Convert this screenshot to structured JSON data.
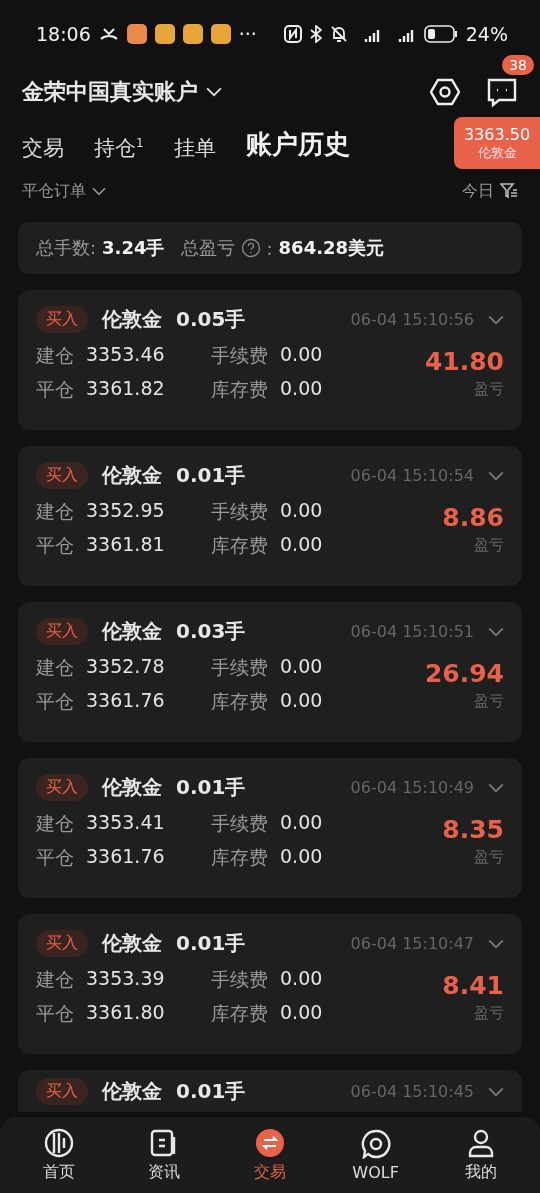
{
  "status_bar": {
    "time": "18:06",
    "more": "···",
    "battery_text": "24%"
  },
  "header": {
    "account": "金荣中国真实账户",
    "badge": "38",
    "price": {
      "value": "3363.50",
      "symbol": "伦敦金"
    }
  },
  "tabs": [
    {
      "label": "交易",
      "selected": false
    },
    {
      "label": "持仓$^{1}$",
      "selected": false
    },
    {
      "label": "挂单",
      "selected": false
    },
    {
      "label": "账户历史",
      "selected": true
    }
  ],
  "filter": {
    "type": "平仓订单",
    "range": "今日"
  },
  "summary": {
    "lots_label": "总手数:",
    "lots": "3.24手",
    "pnl_label": "总盈亏",
    "pnl_colon": ":",
    "pnl": "864.28美元"
  },
  "orders": [
    {
      "side": "买入",
      "symbol": "伦敦金",
      "lots": "0.05手",
      "time": "06-04 15:10:56",
      "fields": [
        {
          "label": "建仓",
          "value": "3353.46"
        },
        {
          "label": "手续费",
          "value": "0.00"
        },
        {
          "label": "平仓",
          "value": "3361.82"
        },
        {
          "label": "库存费",
          "value": "0.00"
        }
      ],
      "profit": "41.80",
      "profit_label": "盈亏"
    },
    {
      "side": "买入",
      "symbol": "伦敦金",
      "lots": "0.01手",
      "time": "06-04 15:10:54",
      "fields": [
        {
          "label": "建仓",
          "value": "3352.95"
        },
        {
          "label": "手续费",
          "value": "0.00"
        },
        {
          "label": "平仓",
          "value": "3361.81"
        },
        {
          "label": "库存费",
          "value": "0.00"
        }
      ],
      "profit": "8.86",
      "profit_label": "盈亏"
    },
    {
      "side": "买入",
      "symbol": "伦敦金",
      "lots": "0.03手",
      "time": "06-04 15:10:51",
      "fields": [
        {
          "label": "建仓",
          "value": "3352.78"
        },
        {
          "label": "手续费",
          "value": "0.00"
        },
        {
          "label": "平仓",
          "value": "3361.76"
        },
        {
          "label": "库存费",
          "value": "0.00"
        }
      ],
      "profit": "26.94",
      "profit_label": "盈亏"
    },
    {
      "side": "买入",
      "symbol": "伦敦金",
      "lots": "0.01手",
      "time": "06-04 15:10:49",
      "fields": [
        {
          "label": "建仓",
          "value": "3353.41"
        },
        {
          "label": "手续费",
          "value": "0.00"
        },
        {
          "label": "平仓",
          "value": "3361.76"
        },
        {
          "label": "库存费",
          "value": "0.00"
        }
      ],
      "profit": "8.35",
      "profit_label": "盈亏"
    },
    {
      "side": "买入",
      "symbol": "伦敦金",
      "lots": "0.01手",
      "time": "06-04 15:10:47",
      "fields": [
        {
          "label": "建仓",
          "value": "3353.39"
        },
        {
          "label": "手续费",
          "value": "0.00"
        },
        {
          "label": "平仓",
          "value": "3361.80"
        },
        {
          "label": "库存费",
          "value": "0.00"
        }
      ],
      "profit": "8.41",
      "profit_label": "盈亏"
    }
  ],
  "partial_order": {
    "side": "买入",
    "symbol": "伦敦金",
    "lots": "0.01手",
    "time": "06-04 15:10:45"
  },
  "nav": [
    {
      "label": "首页",
      "selected": false
    },
    {
      "label": "资讯",
      "selected": false
    },
    {
      "label": "交易",
      "selected": true
    },
    {
      "label": "WOLF",
      "selected": false
    },
    {
      "label": "我的",
      "selected": false
    }
  ]
}
